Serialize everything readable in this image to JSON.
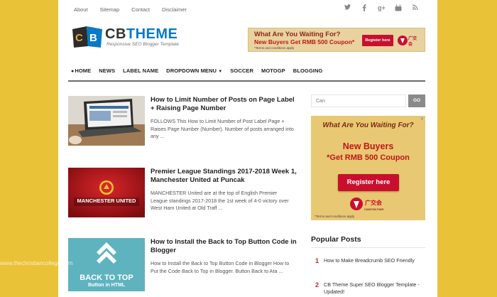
{
  "topbar": {
    "links": [
      "About",
      "Sitemap",
      "Contact",
      "Disclaimer"
    ],
    "social_icons": [
      "twitter-icon",
      "facebook-icon",
      "google-plus-icon",
      "youtube-icon",
      "rss-icon"
    ]
  },
  "logo": {
    "mark": "CB",
    "title_a": "CB",
    "title_b": "THEME",
    "subtitle": "Responsive SEO Blogger Template"
  },
  "header_banner": {
    "line1": "What Are You Waiting For?",
    "line2": "New Buyers Get RMB 500 Coupon*",
    "line3": "*Terms and conditions apply",
    "button": "Register here"
  },
  "nav": {
    "items": [
      "HOME",
      "NEWS",
      "LABEL NAME",
      "DROPDOWN MENU",
      "SOCCER",
      "MOTOGP",
      "BLOGGING"
    ]
  },
  "posts": [
    {
      "title": "How to Limit Number of Posts on Page Label + Raising Page Number",
      "excerpt": "FOLLOWS This How to Limit Number of Post Label Page + Raises Page Number (Number). Number of posts arranged into any ..."
    },
    {
      "title": "Premier League Standings 2017-2018 Week 1, Manchester United at Puncak",
      "excerpt": "MANCHESTER United are at the top of English Premier League standings 2017-2018 the 1st week of 4-0 victory over West Ham United at Old Traff ...",
      "thumb_text": "MANCHESTER UNITED"
    },
    {
      "title": "How to Install the Back to Top Button Code in Blogger",
      "excerpt": "How to Install the Back to Top Button Code in Blogger How to Put the Code Back to Top in Blogger. Button Back to Ata ...",
      "thumb_text_1": "BACK TO TOP",
      "thumb_text_2": "Button in HTML"
    }
  ],
  "sidebar": {
    "search_placeholder": "Can",
    "search_button": "GO",
    "ad": {
      "line1": "What Are You Waiting For?",
      "line2": "New Buyers",
      "line3": "*Get RMB 500 Coupon",
      "button": "Register here",
      "logo_text": "CANTON FAIR",
      "terms": "*Terms and conditions apply"
    },
    "popular_title": "Popular Posts",
    "popular": [
      {
        "num": "1",
        "text": "How to Make Breadcrumb SEO Friendly"
      },
      {
        "num": "2",
        "text": "CB Theme Super SEO Blogger Template - Updated!"
      }
    ]
  },
  "watermark": "www.thechristiancollege.com",
  "colors": {
    "background": "#e9c237",
    "brand_blue": "#0b79c4",
    "accent_red": "#c0261e"
  }
}
